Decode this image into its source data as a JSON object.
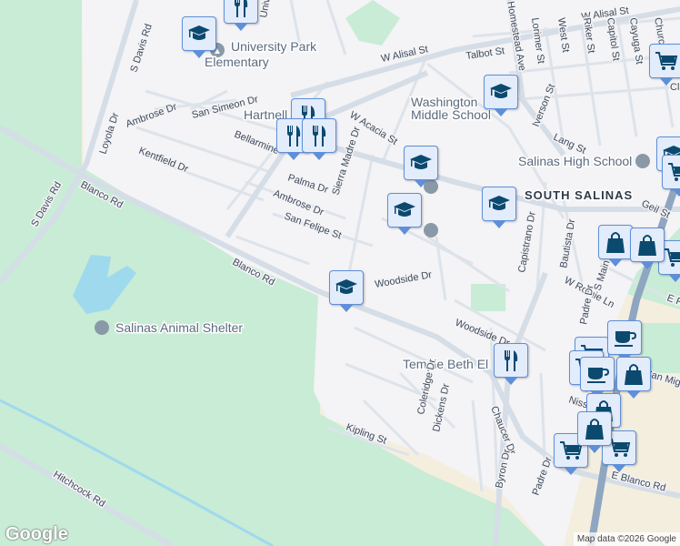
{
  "map": {
    "neighborhood": "SOUTH SALINAS",
    "places": {
      "university_park": "University Park Elementary",
      "university_park_l1": "University Park",
      "university_park_l2": "Elementary",
      "washington_l1": "Washington",
      "washington_l2": "Middle School",
      "salinas_high": "Salinas High School",
      "hartnell_park": "Hartnell Park",
      "animal_shelter": "Salinas Animal Shelter",
      "temple": "Temple Beth El"
    },
    "streets": [
      "S Davis Rd",
      "S Davis Rd",
      "Blanco Rd",
      "Blanco Rd",
      "W Alisal St",
      "W Alisal St",
      "W Acacia St",
      "Talbot St",
      "Homestead Ave",
      "Lorimer St",
      "West St",
      "Riker St",
      "Capitol St",
      "Cayuga St",
      "Church",
      "Iverson St",
      "Lang St",
      "Geil St",
      "San Simeon Dr",
      "Ambrose Dr",
      "Loyola Dr",
      "Kentfield Dr",
      "Bellarmine",
      "Palma Dr",
      "Ambrose Dr",
      "Sierra Madre Dr",
      "San Felipe St",
      "Woodside Dr",
      "Woodside Dr",
      "Capistrano Dr",
      "Bautista Dr",
      "W Romie Ln",
      "Padre Dr",
      "S Main St",
      "E R",
      "Coleridge Dr",
      "Dickens Dr",
      "Chaucer Dr",
      "Byron Dr",
      "Kipling St",
      "Padre Dr",
      "E Blanco Rd",
      "Hitchcock Rd",
      "Nissan",
      "San Miguel",
      "Cla",
      "Univ"
    ],
    "markers": [
      {
        "type": "school"
      },
      {
        "type": "school"
      },
      {
        "type": "school"
      },
      {
        "type": "school"
      },
      {
        "type": "school"
      },
      {
        "type": "school"
      },
      {
        "type": "school"
      },
      {
        "type": "restaurant"
      },
      {
        "type": "restaurant"
      },
      {
        "type": "restaurant"
      },
      {
        "type": "restaurant"
      },
      {
        "type": "restaurant"
      },
      {
        "type": "grocery"
      },
      {
        "type": "grocery"
      },
      {
        "type": "grocery"
      },
      {
        "type": "grocery"
      },
      {
        "type": "grocery"
      },
      {
        "type": "grocery"
      },
      {
        "type": "grocery"
      },
      {
        "type": "coffee"
      },
      {
        "type": "coffee"
      },
      {
        "type": "shopping"
      },
      {
        "type": "shopping"
      },
      {
        "type": "shopping"
      },
      {
        "type": "shopping"
      },
      {
        "type": "shopping"
      }
    ],
    "colors": {
      "park": "#c8ecd5",
      "urban": "#f4f3f5",
      "commercial": "#f4eedf",
      "road": "#d5dde7",
      "highway": "#8fa6c0",
      "marker_bg": "#e3ecfb",
      "marker_border": "#5e8fd8",
      "icon": "#0b4a6e",
      "water": "#9fd9ee"
    }
  },
  "footer": {
    "logo": "Google",
    "attribution": "Map data ©2026 Google"
  }
}
